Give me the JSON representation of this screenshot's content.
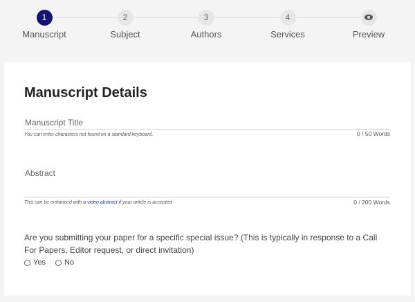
{
  "stepper": {
    "steps": [
      {
        "number": "1",
        "label": "Manuscript",
        "active": true
      },
      {
        "number": "2",
        "label": "Subject",
        "active": false
      },
      {
        "number": "3",
        "label": "Authors",
        "active": false
      },
      {
        "number": "4",
        "label": "Services",
        "active": false
      },
      {
        "number": "",
        "icon": "eye-icon",
        "label": "Preview",
        "active": false
      }
    ],
    "active_color": "#14146e"
  },
  "form": {
    "heading": "Manuscript Details",
    "title_field": {
      "label": "Manuscript Title",
      "hint": "You can enter characters not found on a standard keyboard.",
      "counter": "0 / 50 Words"
    },
    "abstract_field": {
      "label": "Abstract",
      "hint_before": "This can be enhanced with a ",
      "hint_link": "video abstract",
      "hint_after": " if your article is accepted",
      "counter": "0 / 200 Words"
    },
    "special_issue": {
      "question": "Are you submitting your paper for a specific special issue? (This is typically in response to a Call For Papers, Editor request, or direct invitation)",
      "options": [
        "Yes",
        "No"
      ]
    }
  }
}
